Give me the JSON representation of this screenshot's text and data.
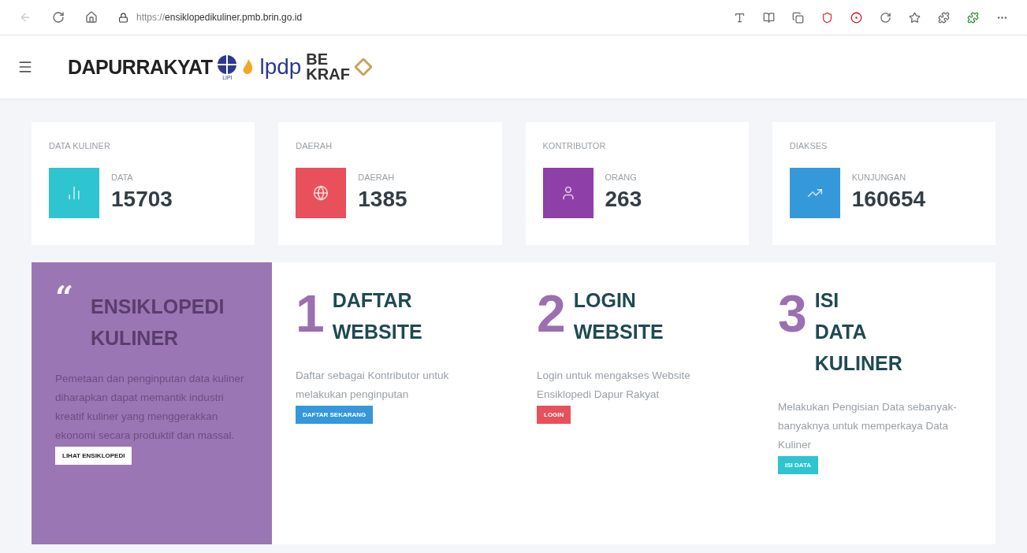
{
  "browser": {
    "url_prefix": "https://",
    "url_host": "ensiklopedikuliner.pmb.brin.go.id"
  },
  "header": {
    "brand": "DAPURRAKYAT",
    "lipi_label": "LIPI",
    "lpdp_label": "lpdp",
    "bekraf_lines": [
      "BE",
      "KRAF"
    ]
  },
  "stats": [
    {
      "title": "DATA KULINER",
      "label": "DATA",
      "value": "15703",
      "color": "#2ec4d0",
      "kind": "chart"
    },
    {
      "title": "DAERAH",
      "label": "DAERAH",
      "value": "1385",
      "color": "#e8505b",
      "kind": "globe"
    },
    {
      "title": "KONTRIBUTOR",
      "label": "ORANG",
      "value": "263",
      "color": "#8e3fa8",
      "kind": "person"
    },
    {
      "title": "DIAKSES",
      "label": "KUNJUNGAN",
      "value": "160654",
      "color": "#3498db",
      "kind": "trend"
    }
  ],
  "intro": {
    "quote_mark": "“",
    "title_lines": [
      "ENSIKLOPEDI",
      "KULINER"
    ],
    "text": "Pemetaan dan penginputan data kuliner diharapkan dapat memantik industri kreatif kuliner yang menggerakkan ekonomi secara produktif dan massal.",
    "button": "LIHAT ENSIKLOPEDI"
  },
  "steps": [
    {
      "number": "1",
      "title_lines": [
        "DAFTAR",
        "WEBSITE"
      ],
      "text": "Daftar sebagai Kontributor untuk melakukan penginputan",
      "button": "DAFTAR SEKARANG",
      "color": "#3498db"
    },
    {
      "number": "2",
      "title_lines": [
        "LOGIN",
        "WEBSITE"
      ],
      "text": "Login untuk mengakses Website Ensiklopedi Dapur Rakyat",
      "button": "LOGIN",
      "color": "#e8505b"
    },
    {
      "number": "3",
      "title_lines": [
        "ISI",
        "DATA",
        "KULINER"
      ],
      "text": "Melakukan Pengisian Data sebanyak-banyaknya untuk memperkaya Data Kuliner",
      "button": "ISI DATA",
      "color": "#2ec4d0"
    }
  ]
}
